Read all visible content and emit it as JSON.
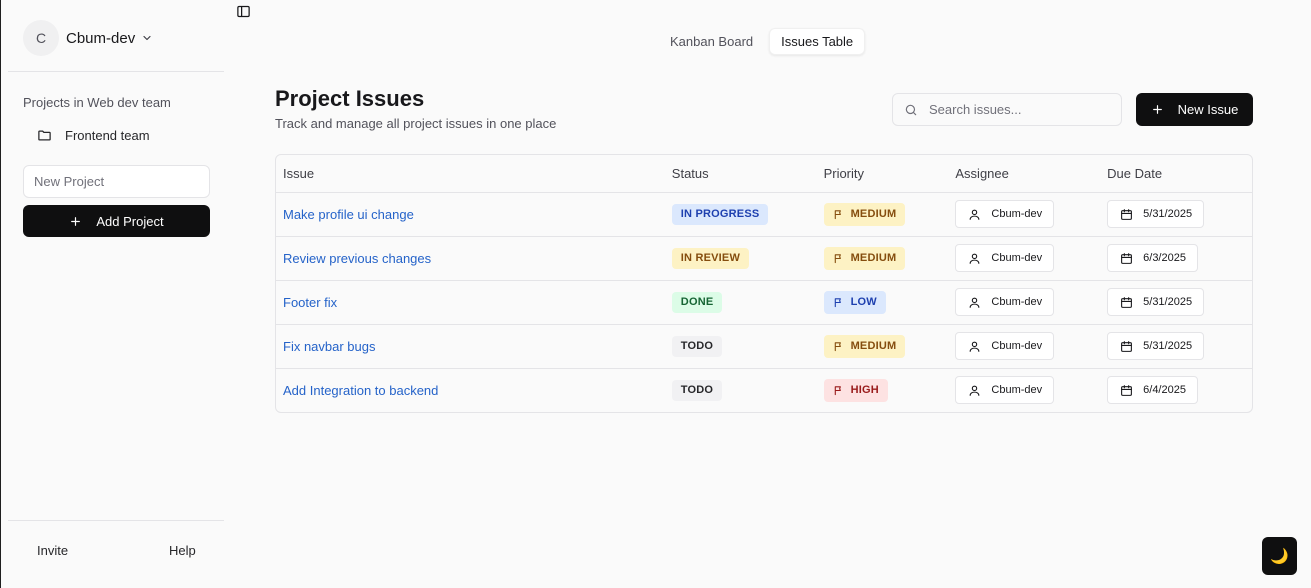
{
  "workspace": {
    "avatar_initial": "C",
    "name": "Cbum-dev"
  },
  "sidebar": {
    "heading": "Projects in Web dev team",
    "projects": [
      {
        "label": "Frontend team"
      }
    ],
    "new_project_placeholder": "New Project",
    "add_project_label": "Add Project",
    "footer": {
      "invite": "Invite",
      "help": "Help"
    }
  },
  "tabs": [
    {
      "label": "Kanban Board",
      "active": false
    },
    {
      "label": "Issues Table",
      "active": true
    }
  ],
  "header": {
    "title": "Project Issues",
    "subtitle": "Track and manage all project issues in one place",
    "search_placeholder": "Search issues...",
    "new_issue_label": "New Issue"
  },
  "table": {
    "columns": [
      "Issue",
      "Status",
      "Priority",
      "Assignee",
      "Due Date"
    ],
    "rows": [
      {
        "issue": "Make profile ui change",
        "status": "IN PROGRESS",
        "priority": "MEDIUM",
        "assignee": "Cbum-dev",
        "due": "5/31/2025"
      },
      {
        "issue": "Review previous changes",
        "status": "IN REVIEW",
        "priority": "MEDIUM",
        "assignee": "Cbum-dev",
        "due": "6/3/2025"
      },
      {
        "issue": "Footer fix",
        "status": "DONE",
        "priority": "LOW",
        "assignee": "Cbum-dev",
        "due": "5/31/2025"
      },
      {
        "issue": "Fix navbar bugs",
        "status": "TODO",
        "priority": "MEDIUM",
        "assignee": "Cbum-dev",
        "due": "5/31/2025"
      },
      {
        "issue": "Add Integration to backend",
        "status": "TODO",
        "priority": "HIGH",
        "assignee": "Cbum-dev",
        "due": "6/4/2025"
      }
    ]
  },
  "status_colors": {
    "IN PROGRESS": {
      "bg": "#dbe8fd",
      "fg": "#1e40af"
    },
    "IN REVIEW": {
      "bg": "#fdf2c4",
      "fg": "#854d0e"
    },
    "DONE": {
      "bg": "#dcfce7",
      "fg": "#166534"
    },
    "TODO": {
      "bg": "#f1f1f3",
      "fg": "#27272a"
    }
  },
  "priority_colors": {
    "MEDIUM": {
      "bg": "#fdf2c4",
      "fg": "#854d0e"
    },
    "LOW": {
      "bg": "#dbe8fd",
      "fg": "#1e40af"
    },
    "HIGH": {
      "bg": "#fde2e2",
      "fg": "#991b1b"
    }
  },
  "theme_toggle_icon": "moon-icon"
}
